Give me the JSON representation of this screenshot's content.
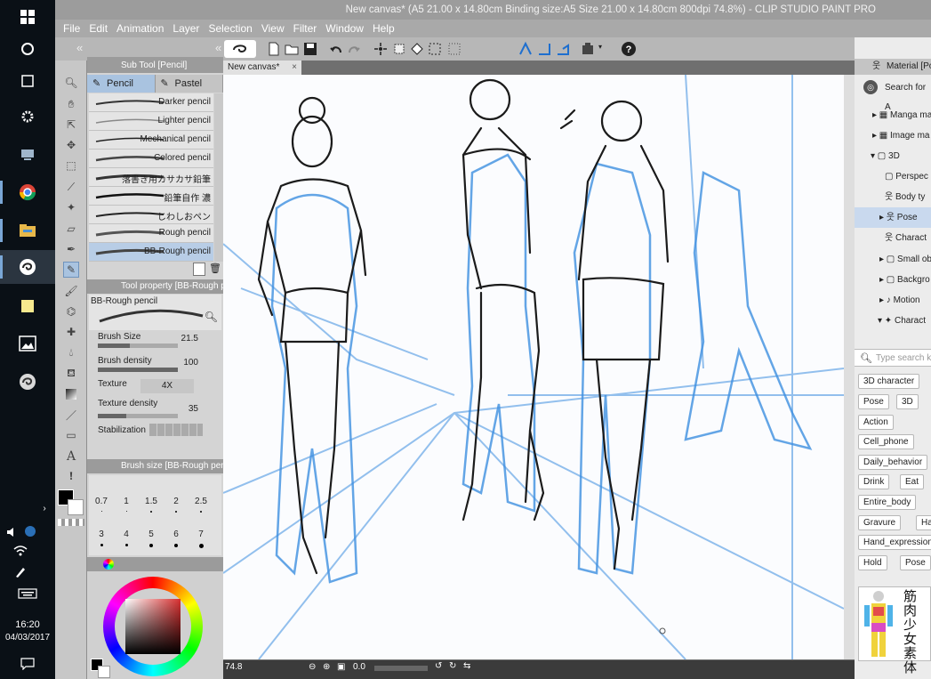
{
  "window": {
    "title": "New canvas* (A5 21.00 x 14.80cm Binding size:A5 Size 21.00 x 14.80cm 800dpi 74.8%) - CLIP STUDIO PAINT PRO"
  },
  "menu": [
    "File",
    "Edit",
    "Animation",
    "Layer",
    "Selection",
    "View",
    "Filter",
    "Window",
    "Help"
  ],
  "taskbar": {
    "time": "16:20",
    "date": "04/03/2017"
  },
  "subtool": {
    "header": "Sub Tool [Pencil]",
    "tabs": [
      "Pencil",
      "Pastel"
    ],
    "brushes": [
      "Darker pencil",
      "Lighter pencil",
      "Mechanical pencil",
      "Colored pencil",
      "落書き用カサカサ鉛筆",
      "鉛筆自作 濃",
      "じわしおペン",
      "Rough pencil",
      "BB-Rough pencil"
    ],
    "selected_index": 8
  },
  "tool_property": {
    "header": "Tool property [BB-Rough pe",
    "brush_name": "BB-Rough pencil",
    "brush_size_label": "Brush Size",
    "brush_size_value": "21.5",
    "brush_density_label": "Brush density",
    "brush_density_value": "100",
    "texture_label": "Texture",
    "texture_value": "4X",
    "texture_density_label": "Texture density",
    "texture_density_value": "35",
    "stabilization_label": "Stabilization"
  },
  "brush_size_palette": {
    "header": "Brush size [BB-Rough pencil]",
    "sizes": [
      "0.7",
      "1",
      "1.5",
      "2",
      "2.5",
      "3",
      "4",
      "5",
      "6",
      "7"
    ]
  },
  "canvas": {
    "tab_label": "New canvas*",
    "zoom_readout": "74.8",
    "angle_readout": "0.0"
  },
  "material": {
    "header": "Material [Po",
    "search_label": "Search for A",
    "tree": [
      "Manga ma",
      "Image ma",
      "3D",
      "Perspec",
      "Body ty",
      "Pose",
      "Charact",
      "Small ob",
      "Backgro",
      "Motion",
      "Charact"
    ],
    "selected_tree_index": 5,
    "tag_search_placeholder": "Type search k",
    "tags": [
      "3D character",
      "Pose",
      "3D",
      "Action",
      "Cell_phone",
      "Daily_behavior",
      "Drink",
      "Eat",
      "Entire_body",
      "Gravure",
      "Ha",
      "Hand_expression",
      "Hold",
      "Pose"
    ],
    "preview_text": "筋肉少女素体"
  },
  "colors": {
    "accent_blue": "#a9c3e0",
    "sketch_blue": "#3d8fe0",
    "sketch_black": "#1b1b1b",
    "main_color": "#000000",
    "sub_color": "#ffffff",
    "color_picker_hue": "#d83030"
  }
}
